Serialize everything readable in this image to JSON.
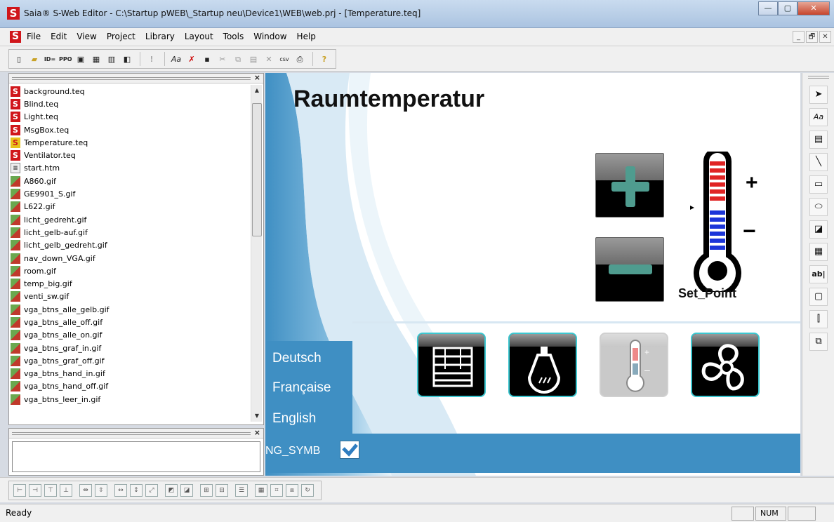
{
  "window": {
    "title": "Saia® S-Web Editor - C:\\Startup pWEB\\_Startup neu\\Device1\\WEB\\web.prj - [Temperature.teq]",
    "logo_letter": "S",
    "min_glyph": "—",
    "max_glyph": "▢",
    "close_glyph": "✕"
  },
  "menu": {
    "items": [
      "File",
      "Edit",
      "View",
      "Project",
      "Library",
      "Layout",
      "Tools",
      "Window",
      "Help"
    ],
    "mdi": [
      "_",
      "🗗",
      "✕"
    ]
  },
  "toolbar": {
    "buttons": [
      "new",
      "open",
      "ID=",
      "PPO",
      "save-all",
      "html",
      "grid",
      "build",
      "warning",
      "text-format",
      "remove",
      "save",
      "cut",
      "copy",
      "paste",
      "delete",
      "csv",
      "print",
      "help"
    ]
  },
  "files": {
    "panel_close": "×",
    "items": [
      {
        "name": "background.teq",
        "type": "teq"
      },
      {
        "name": "Blind.teq",
        "type": "teq"
      },
      {
        "name": "Light.teq",
        "type": "teq"
      },
      {
        "name": "MsgBox.teq",
        "type": "teq"
      },
      {
        "name": "Temperature.teq",
        "type": "teq-sel"
      },
      {
        "name": "Ventilator.teq",
        "type": "teq"
      },
      {
        "name": "start.htm",
        "type": "htm"
      },
      {
        "name": "A860.gif",
        "type": "gif"
      },
      {
        "name": "GE9901_S.gif",
        "type": "gif"
      },
      {
        "name": "L622.gif",
        "type": "gif"
      },
      {
        "name": "licht_gedreht.gif",
        "type": "gif"
      },
      {
        "name": "licht_gelb-auf.gif",
        "type": "gif"
      },
      {
        "name": "licht_gelb_gedreht.gif",
        "type": "gif"
      },
      {
        "name": "nav_down_VGA.gif",
        "type": "gif"
      },
      {
        "name": "room.gif",
        "type": "gif"
      },
      {
        "name": "temp_big.gif",
        "type": "gif"
      },
      {
        "name": "venti_sw.gif",
        "type": "gif"
      },
      {
        "name": "vga_btns_alle_gelb.gif",
        "type": "gif"
      },
      {
        "name": "vga_btns_alle_off.gif",
        "type": "gif"
      },
      {
        "name": "vga_btns_alle_on.gif",
        "type": "gif"
      },
      {
        "name": "vga_btns_graf_in.gif",
        "type": "gif"
      },
      {
        "name": "vga_btns_graf_off.gif",
        "type": "gif"
      },
      {
        "name": "vga_btns_hand_in.gif",
        "type": "gif"
      },
      {
        "name": "vga_btns_hand_off.gif",
        "type": "gif"
      },
      {
        "name": "vga_btns_leer_in.gif",
        "type": "gif"
      }
    ]
  },
  "output_panel": {
    "close": "×"
  },
  "canvas": {
    "title": "Raumtemperatur",
    "setpoint_label": "Set_Point",
    "plus_sign": "+",
    "minus_sign": "−",
    "languages": [
      "Deutsch",
      "Française",
      "English"
    ],
    "lang_symbol": "NG_SYMB",
    "nav_buttons": [
      "blinds",
      "light",
      "temperature",
      "ventilator"
    ],
    "colors": {
      "blue": "#3f8fc3",
      "teal": "#4f9c8f",
      "cyan_border": "#3cc7d0"
    }
  },
  "right_tools": [
    "select-arrow",
    "text",
    "text-box",
    "line",
    "rectangle",
    "ellipse",
    "bitmap",
    "barcode",
    "edit-field",
    "button",
    "slider",
    "group"
  ],
  "right_tool_glyphs": [
    "➤",
    "Aa",
    "▤",
    "╲",
    "▭",
    "⬭",
    "◪",
    "▦",
    "ab|",
    "▢",
    "⫿",
    "⧉"
  ],
  "status": {
    "text": "Ready",
    "num": "NUM"
  }
}
